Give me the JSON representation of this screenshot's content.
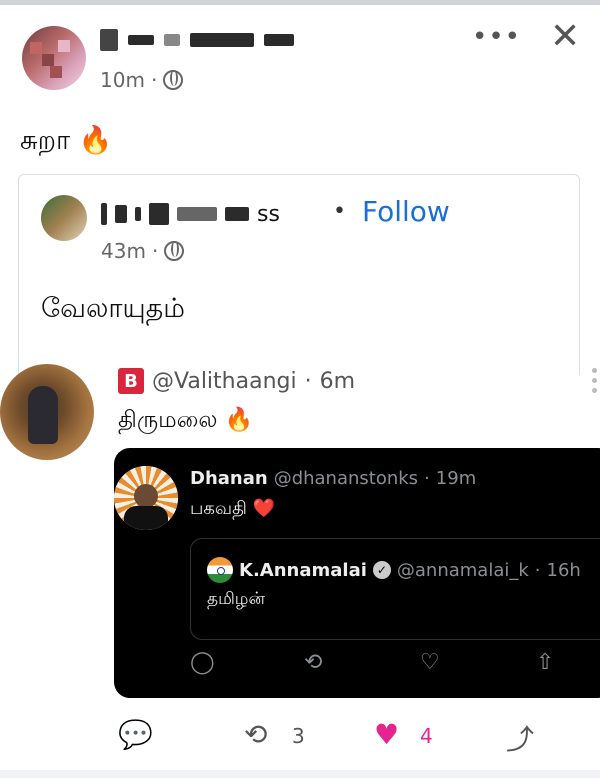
{
  "post": {
    "time": "10m",
    "dot": "·",
    "text": "சுறா 🔥",
    "more_icon": "more-horizontal-icon",
    "close_icon": "close-icon"
  },
  "shared": {
    "name_tail": "ss",
    "dot": "•",
    "follow_label": "Follow",
    "time": "43m",
    "meta_dot": "·",
    "text": "வேலாயுதம்"
  },
  "tweet": {
    "badge": "B",
    "handle": "@Valithaangi",
    "dot": "·",
    "time": "6m",
    "text": "திருமலை 🔥"
  },
  "quoted": {
    "name": "Dhanan",
    "handle": "@dhananstonks",
    "dot": "·",
    "time": "19m",
    "text": "பகவதி ❤️"
  },
  "inner_quoted": {
    "name": "K.Annamalai",
    "handle": "@annamalai_k",
    "dot": "·",
    "time": "16h",
    "text": "தமிழன்"
  },
  "actions": {
    "reposts": "3",
    "likes": "4"
  },
  "colors": {
    "follow": "#1a6ed8",
    "like": "#e6238e",
    "badge": "#d7263d"
  }
}
